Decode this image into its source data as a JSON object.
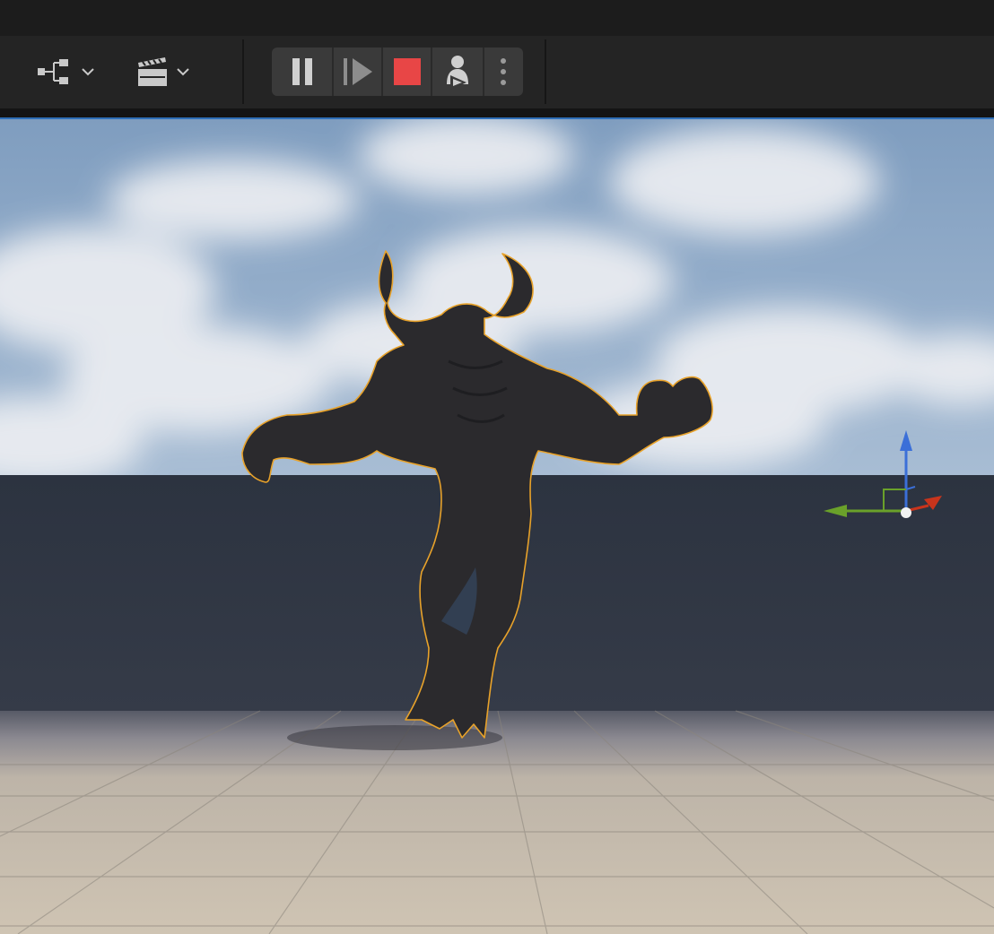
{
  "toolbar": {
    "buttons": [
      {
        "name": "blueprint-hierarchy-button",
        "icon": "hierarchy-icon"
      },
      {
        "name": "cinematics-button",
        "icon": "clapperboard-icon"
      }
    ],
    "play_controls": [
      {
        "name": "pause-button",
        "icon": "pause-icon"
      },
      {
        "name": "step-frame-button",
        "icon": "step-forward-icon"
      },
      {
        "name": "stop-button",
        "icon": "stop-icon",
        "color": "#e84646"
      },
      {
        "name": "possess-eject-button",
        "icon": "possess-player-icon"
      },
      {
        "name": "more-options-button",
        "icon": "vertical-dots-icon"
      }
    ]
  },
  "viewport": {
    "scene": "level viewport",
    "selected_actor_outline_color": "#e8a22a",
    "gizmo_colors": {
      "x": "#c8341c",
      "y": "#6aa12a",
      "z": "#3b6fd8"
    }
  }
}
